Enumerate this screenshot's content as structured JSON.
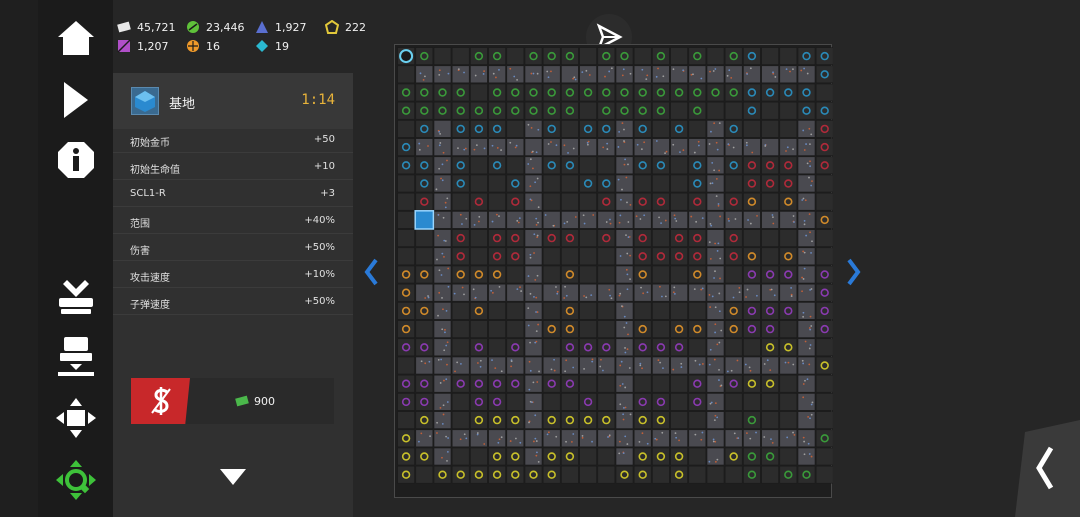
{
  "resources": [
    {
      "name": "gold",
      "value": "45,721",
      "color": "#e8e8e8"
    },
    {
      "name": "green",
      "value": "23,446",
      "color": "#5fc23a"
    },
    {
      "name": "blue",
      "value": "1,927",
      "color": "#5a6fd0"
    },
    {
      "name": "yellow",
      "value": "222",
      "color": "#e2c83a"
    },
    {
      "name": "purple",
      "value": "1,207",
      "color": "#b04fc8"
    },
    {
      "name": "orange",
      "value": "16",
      "color": "#f09a2a"
    },
    {
      "name": "cyan",
      "value": "19",
      "color": "#2ab8d0"
    }
  ],
  "panel": {
    "title": "基地",
    "time": "1:14",
    "stats": [
      {
        "label": "初始金币",
        "value": "+50"
      },
      {
        "label": "初始生命值",
        "value": "+10"
      },
      {
        "label": "SCL1-R",
        "value": "+3"
      },
      {
        "label": "范围",
        "value": "+40%"
      },
      {
        "label": "伤害",
        "value": "+50%"
      },
      {
        "label": "攻击速度",
        "value": "+10%"
      },
      {
        "label": "子弹速度",
        "value": "+50%"
      }
    ]
  },
  "sell": {
    "price": "900"
  },
  "sidebar": {
    "icons": [
      "home-icon",
      "play-icon",
      "info-icon",
      "clear-tiles-icon",
      "tile-layer-icon",
      "move-icon",
      "locate-icon"
    ]
  },
  "colors": {
    "accent_time": "#e8b33a",
    "sell_red": "#c8282a",
    "nav_blue": "#2a7ad8",
    "locate_green": "#3ec23a"
  }
}
